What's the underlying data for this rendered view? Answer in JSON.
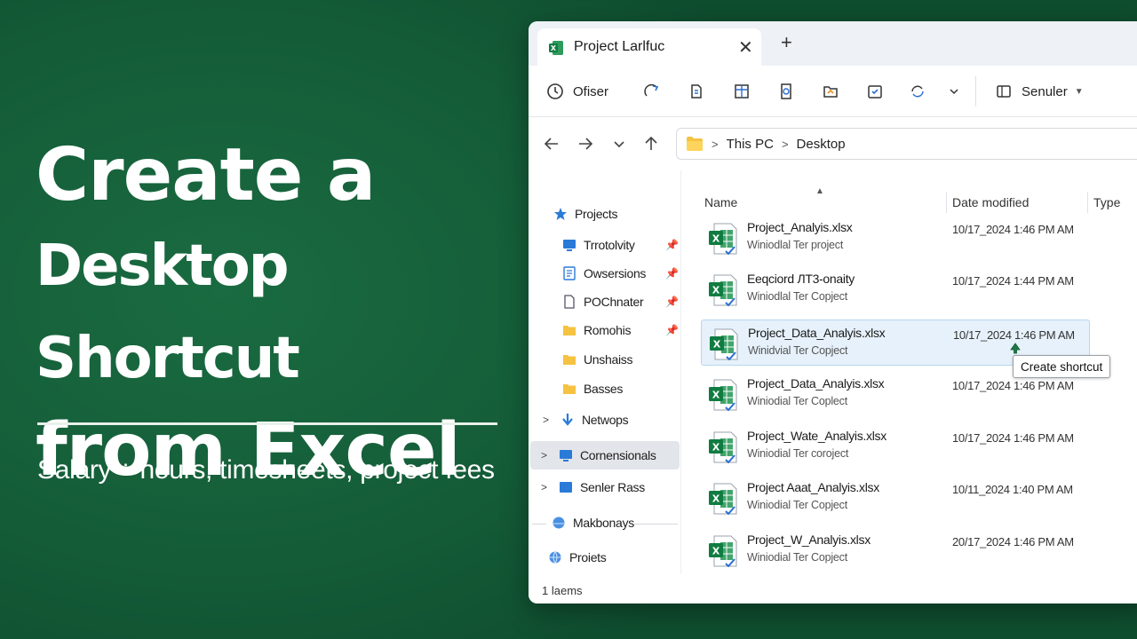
{
  "headline": {
    "line1": "Create a",
    "line2": "Desktop Shortcut",
    "line3": "from Excel",
    "subtitle": "Salary ÷ hours, timesheets, project fees"
  },
  "colors": {
    "background": "#145c38",
    "excel_green": "#1d7a45",
    "selection": "#e6f1fb"
  },
  "window": {
    "tab_title": "Project Larlfuc",
    "tab_icon": "excel-icon",
    "toolbar": {
      "first_label": "Ofiser",
      "right_label": "Senuler",
      "icons": [
        "share-icon",
        "document-icon",
        "table-icon",
        "preview-icon",
        "folder-icon",
        "checklist-icon",
        "sync-icon"
      ]
    },
    "address": {
      "crumbs": [
        "This PC",
        "Desktop"
      ]
    },
    "nav": {
      "items": [
        {
          "label": "Projects",
          "icon": "star-icon"
        },
        {
          "label": "Trrotolvity",
          "icon": "monitor-icon",
          "pinned": true
        },
        {
          "label": "Owsersions",
          "icon": "doc-icon",
          "pinned": true
        },
        {
          "label": "POChnater",
          "icon": "page-icon",
          "pinned": true
        },
        {
          "label": "Romohis",
          "icon": "folder-icon",
          "pinned": true
        },
        {
          "label": "Unshaiss",
          "icon": "folder-icon"
        },
        {
          "label": "Basses",
          "icon": "folder-icon"
        },
        {
          "label": "Netwops",
          "icon": "download-icon"
        },
        {
          "label": "Cornensionals",
          "icon": "monitor-icon"
        },
        {
          "label": "Senler Rass",
          "icon": "screen-icon"
        },
        {
          "label": "Makbonays",
          "icon": "cloud-icon"
        },
        {
          "label": "Proiets",
          "icon": "globe-icon"
        }
      ]
    },
    "columns": {
      "name": "Name",
      "date": "Date modified",
      "type": "Type"
    },
    "files": [
      {
        "name": "Project_Analyis.xlsx",
        "sub": "Winiodlal Ter project",
        "date": "10/17_2024   1:46 PM AM"
      },
      {
        "name": "Eeqciord ЛТ3-onaity",
        "sub": "Winiodlal Ter Copject",
        "date": "10/17_2024   1:44 PM AM"
      },
      {
        "name": "Project_Data_Analyis.xlsx",
        "sub": "Winidvial Ter Copject",
        "date": "10/17_2024   1:46 PM AM"
      },
      {
        "name": "Project_Data_Analyis.xlsx",
        "sub": "Winiodial Ter Coplect",
        "date": "10/17_2024   1:46 PM AM"
      },
      {
        "name": "Project_Wate_Analyis.xlsx",
        "sub": "Winiodial Ter coroject",
        "date": "10/17_2024   1:46 PM AM"
      },
      {
        "name": "Project Aaat_Analyis.xlsx",
        "sub": "Winiodial Ter Copject",
        "date": "10/11_2024   1:40 PM AM"
      },
      {
        "name": "Project_W_Analyis.xlsx",
        "sub": "Winiodial Ter Copject",
        "date": "20/17_2024   1:46 PM AM"
      }
    ],
    "tooltip": "Create shortcut",
    "status": "1  laems"
  }
}
